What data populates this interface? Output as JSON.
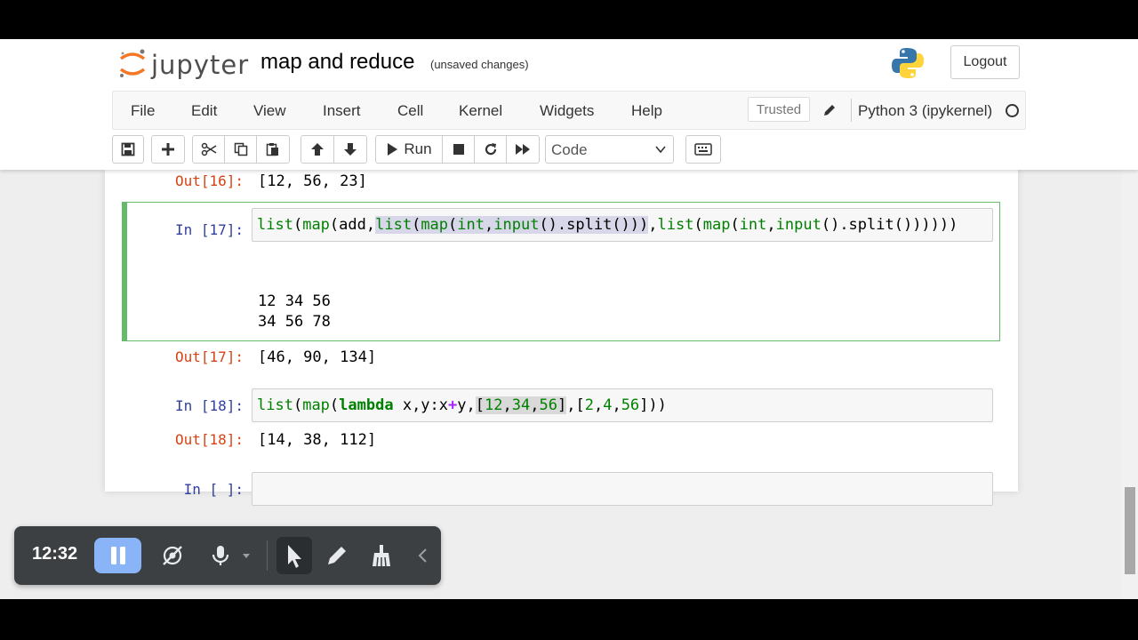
{
  "header": {
    "logo_text": "jupyter",
    "notebook_title": "map and reduce",
    "unsaved": "(unsaved changes)",
    "logout_label": "Logout"
  },
  "menubar": {
    "items": [
      "File",
      "Edit",
      "View",
      "Insert",
      "Cell",
      "Kernel",
      "Widgets",
      "Help"
    ],
    "trusted_label": "Trusted",
    "kernel_name": "Python 3 (ipykernel)"
  },
  "toolbar": {
    "run_label": "Run",
    "cell_type": "Code"
  },
  "cells": {
    "c16": {
      "out_prompt": "Out[16]:",
      "output": "[12, 56, 23]"
    },
    "c17": {
      "in_prompt": "In [17]:",
      "stdout_line1": "12 34 56",
      "stdout_line2": "34 56 78",
      "out_prompt": "Out[17]:",
      "output": "[46, 90, 134]"
    },
    "c18": {
      "in_prompt": "In [18]:",
      "out_prompt": "Out[18]:",
      "output": "[14, 38, 112]"
    },
    "empty": {
      "in_prompt": "In [ ]:"
    }
  },
  "recorder": {
    "timer": "12:32"
  },
  "colors": {
    "selected_cell_border": "#66bb6a",
    "in_prompt": "#303f9f",
    "out_prompt": "#d84315",
    "recorder_bg": "#3c4043",
    "pause_btn": "#8ab4f8"
  }
}
